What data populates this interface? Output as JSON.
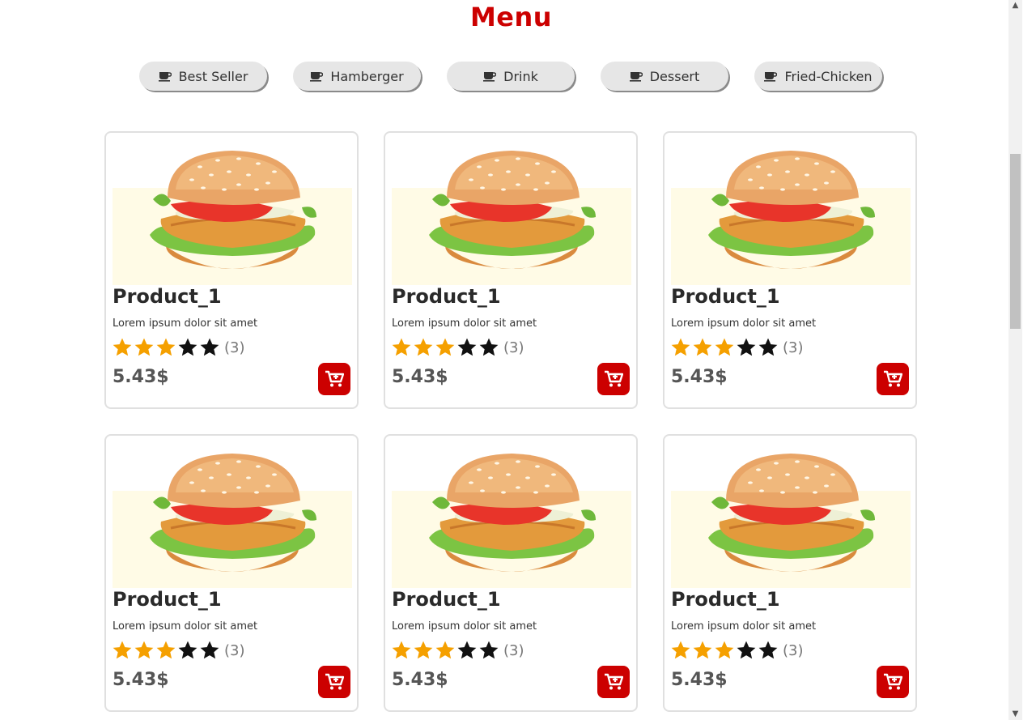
{
  "menu": {
    "title": "Menu"
  },
  "categories": [
    {
      "label": "Best Seller",
      "icon": "coffee-cup-icon"
    },
    {
      "label": "Hamberger",
      "icon": "coffee-cup-icon"
    },
    {
      "label": "Drink",
      "icon": "coffee-cup-icon"
    },
    {
      "label": "Dessert",
      "icon": "coffee-cup-icon"
    },
    {
      "label": "Fried-Chicken",
      "icon": "coffee-cup-icon"
    }
  ],
  "products": [
    {
      "name": "Product_1",
      "description": "Lorem ipsum dolor sit amet",
      "rating": 3,
      "rating_max": 5,
      "rating_count": "(3)",
      "price": "5.43$",
      "image": "burger-image"
    },
    {
      "name": "Product_1",
      "description": "Lorem ipsum dolor sit amet",
      "rating": 3,
      "rating_max": 5,
      "rating_count": "(3)",
      "price": "5.43$",
      "image": "burger-image"
    },
    {
      "name": "Product_1",
      "description": "Lorem ipsum dolor sit amet",
      "rating": 3,
      "rating_max": 5,
      "rating_count": "(3)",
      "price": "5.43$",
      "image": "burger-image"
    },
    {
      "name": "Product_1",
      "description": "Lorem ipsum dolor sit amet",
      "rating": 3,
      "rating_max": 5,
      "rating_count": "(3)",
      "price": "5.43$",
      "image": "burger-image"
    },
    {
      "name": "Product_1",
      "description": "Lorem ipsum dolor sit amet",
      "rating": 3,
      "rating_max": 5,
      "rating_count": "(3)",
      "price": "5.43$",
      "image": "burger-image"
    },
    {
      "name": "Product_1",
      "description": "Lorem ipsum dolor sit amet",
      "rating": 3,
      "rating_max": 5,
      "rating_count": "(3)",
      "price": "5.43$",
      "image": "burger-image"
    }
  ],
  "colors": {
    "accent": "#cc0000",
    "star_filled": "#f5a000",
    "star_empty": "#111111",
    "chip_bg": "#e6e6e6",
    "image_bg": "#fffbe6"
  },
  "cart_icon": "add-to-cart-icon"
}
